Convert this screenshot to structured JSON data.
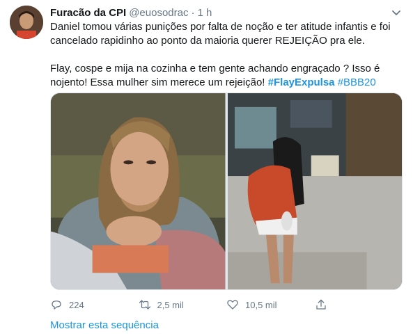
{
  "tweet": {
    "author": {
      "display_name": "Furacão da CPI",
      "handle": "@euosodrac",
      "separator": "·",
      "time": "1 h"
    },
    "paragraph1": "Daniel tomou várias punições por falta de noção e ter atitude infantis e foi cancelado rapidinho ao ponto da maioria querer REJEIÇÃO pra ele.",
    "paragraph2_text": "Flay, cospe e mija na cozinha e tem gente achando engraçado ? Isso é nojento! Essa mulher sim merece um rejeição! ",
    "hashtags": [
      "#FlayExpulsa",
      "#BBB20"
    ],
    "media": [
      {
        "icon": "photo-daniel"
      },
      {
        "icon": "photo-flay"
      }
    ],
    "actions": {
      "reply_count": "224",
      "retweet_count": "2,5 mil",
      "like_count": "10,5 mil"
    },
    "show_thread_label": "Mostrar esta sequência"
  },
  "colors": {
    "accent": "#1b95e0",
    "muted": "#657786",
    "text": "#14171a"
  }
}
